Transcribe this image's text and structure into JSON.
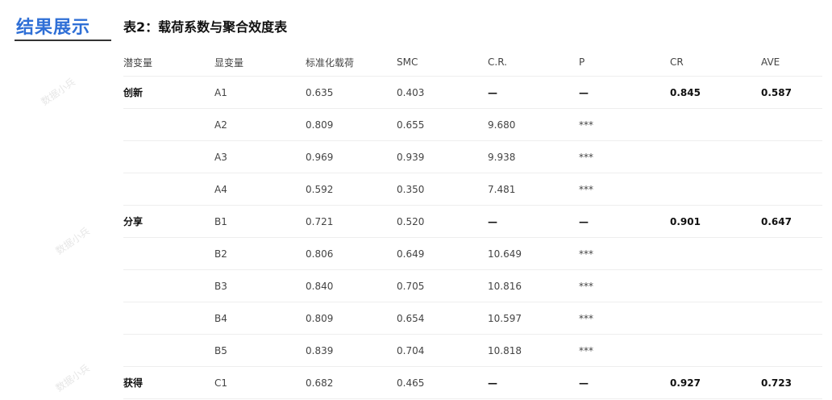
{
  "section": {
    "title": "结果展示"
  },
  "table": {
    "title": "表2：载荷系数与聚合效度表",
    "headers": [
      "潜变量",
      "显变量",
      "标准化载荷",
      "SMC",
      "C.R.",
      "P",
      "CR",
      "AVE"
    ],
    "rows": [
      {
        "latent": "创新",
        "observed": "A1",
        "loading": "0.635",
        "smc": "0.403",
        "cr_ratio": "—",
        "p": "—",
        "cr": "0.845",
        "ave": "0.587"
      },
      {
        "latent": "",
        "observed": "A2",
        "loading": "0.809",
        "smc": "0.655",
        "cr_ratio": "9.680",
        "p": "***",
        "cr": "",
        "ave": ""
      },
      {
        "latent": "",
        "observed": "A3",
        "loading": "0.969",
        "smc": "0.939",
        "cr_ratio": "9.938",
        "p": "***",
        "cr": "",
        "ave": ""
      },
      {
        "latent": "",
        "observed": "A4",
        "loading": "0.592",
        "smc": "0.350",
        "cr_ratio": "7.481",
        "p": "***",
        "cr": "",
        "ave": ""
      },
      {
        "latent": "分享",
        "observed": "B1",
        "loading": "0.721",
        "smc": "0.520",
        "cr_ratio": "—",
        "p": "—",
        "cr": "0.901",
        "ave": "0.647"
      },
      {
        "latent": "",
        "observed": "B2",
        "loading": "0.806",
        "smc": "0.649",
        "cr_ratio": "10.649",
        "p": "***",
        "cr": "",
        "ave": ""
      },
      {
        "latent": "",
        "observed": "B3",
        "loading": "0.840",
        "smc": "0.705",
        "cr_ratio": "10.816",
        "p": "***",
        "cr": "",
        "ave": ""
      },
      {
        "latent": "",
        "observed": "B4",
        "loading": "0.809",
        "smc": "0.654",
        "cr_ratio": "10.597",
        "p": "***",
        "cr": "",
        "ave": ""
      },
      {
        "latent": "",
        "observed": "B5",
        "loading": "0.839",
        "smc": "0.704",
        "cr_ratio": "10.818",
        "p": "***",
        "cr": "",
        "ave": ""
      },
      {
        "latent": "获得",
        "observed": "C1",
        "loading": "0.682",
        "smc": "0.465",
        "cr_ratio": "—",
        "p": "—",
        "cr": "0.927",
        "ave": "0.723"
      }
    ]
  },
  "watermarks": [
    "数据小兵",
    "数据小兵",
    "数据小兵"
  ]
}
